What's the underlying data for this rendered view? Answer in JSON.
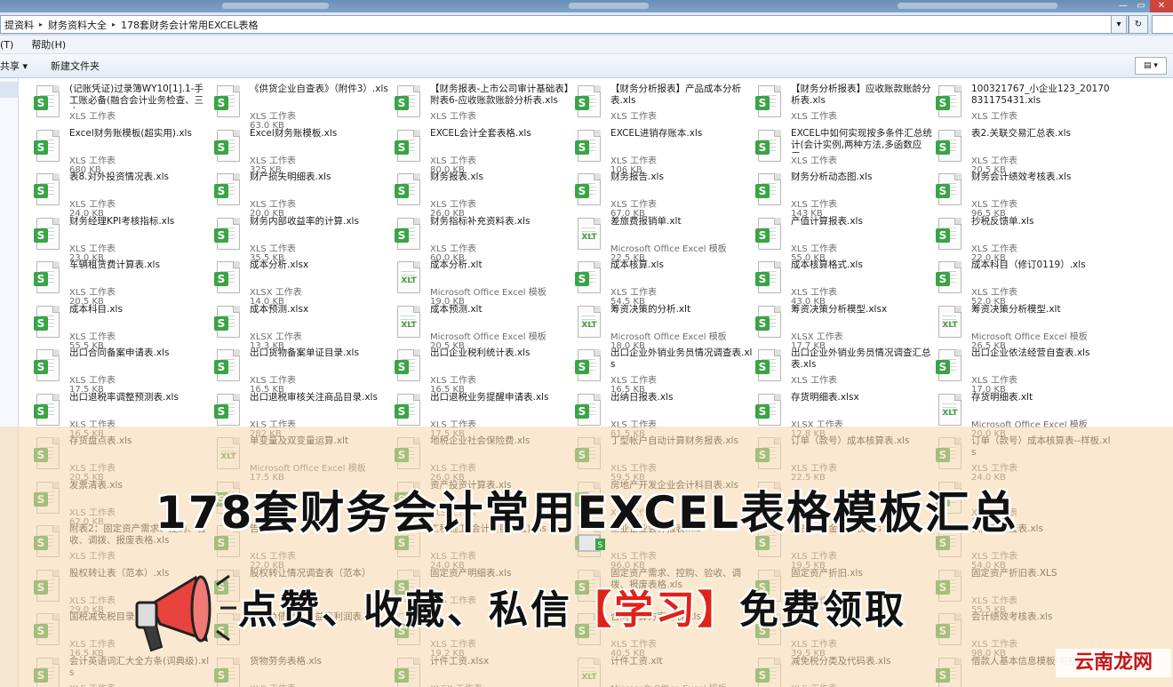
{
  "window": {
    "min": "—",
    "max": "▭",
    "close": "✕"
  },
  "address": {
    "crumbs": [
      "提资料",
      "财务资料大全",
      "178套财务会计常用EXCEL表格"
    ],
    "refresh": "↻",
    "dropdown": "▾"
  },
  "menu": {
    "tools": "(T)",
    "help": "帮助(H)"
  },
  "toolbar": {
    "share": "共享 ▾",
    "new_folder": "新建文件夹",
    "view": "▤ ▾"
  },
  "files": [
    {
      "name": "(记账凭证)过录簿WY10[1].1-手工账必备(融合会计业务检查、三大...",
      "type": "XLS 工作表",
      "size": "",
      "icon": "xls"
    },
    {
      "name": "《供货企业自查表》（附件3）.xls",
      "type": "XLS 工作表",
      "size": "63.0 KB",
      "icon": "xls"
    },
    {
      "name": "【财务报表-上市公司审计基础表】附表6-应收账款账龄分析表.xls",
      "type": "XLS 工作表",
      "size": "",
      "icon": "xls"
    },
    {
      "name": "【财务分析报表】产品成本分析表.xls",
      "type": "XLS 工作表",
      "size": "",
      "icon": "xls"
    },
    {
      "name": "【财务分析报表】应收账款账龄分析表.xls",
      "type": "XLS 工作表",
      "size": "",
      "icon": "xls"
    },
    {
      "name": "100321767_小企业123_20170831175431.xls",
      "type": "XLS 工作表",
      "size": "",
      "icon": "xls"
    },
    {
      "name": "Excel财务账模板(超实用).xls",
      "type": "XLS 工作表",
      "size": "680 KB",
      "icon": "xls"
    },
    {
      "name": "Excel财务账模板.xls",
      "type": "XLS 工作表",
      "size": "325 KB",
      "icon": "xls"
    },
    {
      "name": "EXCEL会计全套表格.xls",
      "type": "XLS 工作表",
      "size": "80.0 KB",
      "icon": "xls"
    },
    {
      "name": "EXCEL进销存账本.xls",
      "type": "XLS 工作表",
      "size": "106 KB",
      "icon": "xls"
    },
    {
      "name": "EXCEL中如何实现按多条件汇总统计(会计实例,两种方法,多函数应用...",
      "type": "XLS 工作表",
      "size": "",
      "icon": "xls"
    },
    {
      "name": "表2.关联交易汇总表.xls",
      "type": "XLS 工作表",
      "size": "20.5 KB",
      "icon": "xls"
    },
    {
      "name": "表8.对外投资情况表.xls",
      "type": "XLS 工作表",
      "size": "24.0 KB",
      "icon": "xls"
    },
    {
      "name": "财产损失明细表.xls",
      "type": "XLS 工作表",
      "size": "20.0 KB",
      "icon": "xls"
    },
    {
      "name": "财务报表.xls",
      "type": "XLS 工作表",
      "size": "26.0 KB",
      "icon": "xls"
    },
    {
      "name": "财务报告.xls",
      "type": "XLS 工作表",
      "size": "67.0 KB",
      "icon": "xls"
    },
    {
      "name": "财务分析动态图.xls",
      "type": "XLS 工作表",
      "size": "143 KB",
      "icon": "xls"
    },
    {
      "name": "财务会计绩效考核表.xls",
      "type": "XLS 工作表",
      "size": "96.5 KB",
      "icon": "xls"
    },
    {
      "name": "财务经理KPI考核指标.xls",
      "type": "XLS 工作表",
      "size": "23.0 KB",
      "icon": "xls"
    },
    {
      "name": "财务内部收益率的计算.xls",
      "type": "XLS 工作表",
      "size": "35.5 KB",
      "icon": "xls"
    },
    {
      "name": "财务指标补充资料表.xls",
      "type": "XLS 工作表",
      "size": "60.0 KB",
      "icon": "xls"
    },
    {
      "name": "差旅费报销单.xlt",
      "type": "Microsoft Office Excel 模板",
      "size": "22.5 KB",
      "icon": "xlt"
    },
    {
      "name": "产值计算报表.xls",
      "type": "XLS 工作表",
      "size": "55.0 KB",
      "icon": "xls"
    },
    {
      "name": "抄税反馈单.xls",
      "type": "XLS 工作表",
      "size": "22.0 KB",
      "icon": "xls"
    },
    {
      "name": "车辆租赁费计算表.xls",
      "type": "XLS 工作表",
      "size": "20.5 KB",
      "icon": "xls"
    },
    {
      "name": "成本分析.xlsx",
      "type": "XLSX 工作表",
      "size": "14.0 KB",
      "icon": "xlsx"
    },
    {
      "name": "成本分析.xlt",
      "type": "Microsoft Office Excel 模板",
      "size": "19.0 KB",
      "icon": "xlt"
    },
    {
      "name": "成本核算.xls",
      "type": "XLS 工作表",
      "size": "54.5 KB",
      "icon": "xls"
    },
    {
      "name": "成本核算格式.xls",
      "type": "XLS 工作表",
      "size": "43.0 KB",
      "icon": "xls"
    },
    {
      "name": "成本科目（修订0119）.xls",
      "type": "XLS 工作表",
      "size": "52.0 KB",
      "icon": "xls"
    },
    {
      "name": "成本科目.xls",
      "type": "XLS 工作表",
      "size": "55.5 KB",
      "icon": "xls"
    },
    {
      "name": "成本预测.xlsx",
      "type": "XLSX 工作表",
      "size": "13.3 KB",
      "icon": "xlsx"
    },
    {
      "name": "成本预测.xlt",
      "type": "Microsoft Office Excel 模板",
      "size": "20.5 KB",
      "icon": "xlt"
    },
    {
      "name": "筹资决策的分析.xlt",
      "type": "Microsoft Office Excel 模板",
      "size": "18.0 KB",
      "icon": "xlt"
    },
    {
      "name": "筹资决策分析模型.xlsx",
      "type": "XLSX 工作表",
      "size": "17.7 KB",
      "icon": "xlsx"
    },
    {
      "name": "筹资决策分析模型.xlt",
      "type": "Microsoft Office Excel 模板",
      "size": "26.5 KB",
      "icon": "xlt"
    },
    {
      "name": "出口合同备案申请表.xls",
      "type": "XLS 工作表",
      "size": "17.5 KB",
      "icon": "xls"
    },
    {
      "name": "出口货物备案单证目录.xls",
      "type": "XLS 工作表",
      "size": "16.5 KB",
      "icon": "xls"
    },
    {
      "name": "出口企业税利统计表.xls",
      "type": "XLS 工作表",
      "size": "16.5 KB",
      "icon": "xls"
    },
    {
      "name": "出口企业外销业务员情况调查表.xls",
      "type": "XLS 工作表",
      "size": "16.5 KB",
      "icon": "xls"
    },
    {
      "name": "出口企业外销业务员情况调查汇总表.xls",
      "type": "XLS 工作表",
      "size": "",
      "icon": "xls"
    },
    {
      "name": "出口企业依法经营自查表.xls",
      "type": "XLS 工作表",
      "size": "17.0 KB",
      "icon": "xls"
    },
    {
      "name": "出口退税率调整预测表.xls",
      "type": "XLS 工作表",
      "size": "16.5 KB",
      "icon": "xls"
    },
    {
      "name": "出口退税审核关注商品目录.xls",
      "type": "XLS 工作表",
      "size": "282 KB",
      "icon": "xls"
    },
    {
      "name": "出口退税业务提醒申请表.xls",
      "type": "XLS 工作表",
      "size": "17.5 KB",
      "icon": "xls"
    },
    {
      "name": "出纳日报表.xls",
      "type": "XLS 工作表",
      "size": "61.5 KB",
      "icon": "xls"
    },
    {
      "name": "存货明细表.xlsx",
      "type": "XLSX 工作表",
      "size": "12.8 KB",
      "icon": "xlsx"
    },
    {
      "name": "存货明细表.xlt",
      "type": "Microsoft Office Excel 模板",
      "size": "20.0 KB",
      "icon": "xlt"
    },
    {
      "name": "存货盘点表.xls",
      "type": "XLS 工作表",
      "size": "20.5 KB",
      "icon": "xls"
    },
    {
      "name": "单变量及双变量运算.xlt",
      "type": "Microsoft Office Excel 模板",
      "size": "17.5 KB",
      "icon": "xlt"
    },
    {
      "name": "地税企业社会保险费.xls",
      "type": "XLS 工作表",
      "size": "26.0 KB",
      "icon": "xls"
    },
    {
      "name": "丁型帐户自动计算财务报表.xls",
      "type": "XLS 工作表",
      "size": "59.5 KB",
      "icon": "xls"
    },
    {
      "name": "订单（款号）成本核算表.xls",
      "type": "XLS 工作表",
      "size": "22.5 KB",
      "icon": "xls"
    },
    {
      "name": "订单（款号）成本核算表--样板.xls",
      "type": "XLS 工作表",
      "size": "24.0 KB",
      "icon": "xls"
    },
    {
      "name": "发票清表.xls",
      "type": "XLS 工作表",
      "size": "62.0 KB",
      "icon": "xls"
    },
    {
      "name": "",
      "type": "",
      "size": "",
      "icon": "xls"
    },
    {
      "name": "资产投资计算表.xls",
      "type": "XLS 工作表",
      "size": "",
      "icon": "xls"
    },
    {
      "name": "房地产开发企业会计科目表.xls",
      "type": "XLS 工作表",
      "size": "",
      "icon": "xls"
    },
    {
      "name": "",
      "type": "",
      "size": "",
      "icon": "xls"
    },
    {
      "name": "",
      "type": "XLS 工作表",
      "size": "16.0 KB",
      "icon": "xls"
    },
    {
      "name": "附表2：固定资产需求、控购、验收、调拨、报废表格.xls",
      "type": "XLS 工作表",
      "size": "",
      "icon": "xls"
    },
    {
      "name": "告表.xls",
      "type": "XLS 工作表",
      "size": "22.0 KB",
      "icon": "xls"
    },
    {
      "name": "工程施工(会计科目设置).xls",
      "type": "XLS 工作表",
      "size": "24.0 KB",
      "icon": "xls"
    },
    {
      "name": "工业企业会计报表.xls",
      "type": "XLS 工作表",
      "size": "96.0 KB",
      "icon": "xls"
    },
    {
      "name": "工资、薪金税额表.xls",
      "type": "XLS 工作表",
      "size": "19.5 KB",
      "icon": "xls"
    },
    {
      "name": "供应商自查表.xls",
      "type": "XLS 工作表",
      "size": "54.0 KB",
      "icon": "xls"
    },
    {
      "name": "股权转让表（范本）.xls",
      "type": "XLS 工作表",
      "size": "29.0 KB",
      "icon": "xls"
    },
    {
      "name": "股权转让情况调查表（范本）",
      "type": "",
      "size": "",
      "icon": "xls"
    },
    {
      "name": "固定资产明细表.xls",
      "type": "XLS 工作表",
      "size": "",
      "icon": "xls"
    },
    {
      "name": "固定资产需求、控购、验收、调拨、报废表格.xls",
      "type": "",
      "size": "",
      "icon": "xls"
    },
    {
      "name": "固定资产折旧.xls",
      "type": "XLS 工作表",
      "size": "",
      "icon": "xls"
    },
    {
      "name": "固定资产折旧表.XLS",
      "type": "XLS 工作表",
      "size": "55.5 KB",
      "icon": "xls"
    },
    {
      "name": "国税减免税目录.xls",
      "type": "XLS 工作表",
      "size": "16.5 KB",
      "icon": "xls"
    },
    {
      "name": "资产负债表、损益表利润表、权...",
      "type": "",
      "size": "",
      "icon": "xls"
    },
    {
      "name": "",
      "type": "XLS 工作表",
      "size": "19.2 KB",
      "icon": "xls"
    },
    {
      "name": "合同预算方案总表.xls",
      "type": "XLS 工作表",
      "size": "40.5 KB",
      "icon": "xls"
    },
    {
      "name": "",
      "type": "XLS 工作表",
      "size": "39.5 KB",
      "icon": "xls"
    },
    {
      "name": "会计绩效考核表.xls",
      "type": "XLS 工作表",
      "size": "98.0 KB",
      "icon": "xls"
    },
    {
      "name": "会计英语词汇大全方条(词典级).xls",
      "type": "XLS 工作表",
      "size": "",
      "icon": "xls"
    },
    {
      "name": "货物劳务表格.xls",
      "type": "XLS 工作表",
      "size": "",
      "icon": "xls"
    },
    {
      "name": "计件工资.xlsx",
      "type": "XLSX 工作表",
      "size": "",
      "icon": "xlsx"
    },
    {
      "name": "计件工资.xlt",
      "type": "Microsoft Office Excel 模板",
      "size": "",
      "icon": "xlt"
    },
    {
      "name": "减免税分类及代码表.xls",
      "type": "XLS 工作表",
      "size": "",
      "icon": "xls"
    },
    {
      "name": "借款人基本信息模板(可打印).xls",
      "type": "",
      "size": "",
      "icon": "xls"
    }
  ],
  "banner": {
    "headline": "178套财务会计常用EXCEL表格模板汇总",
    "sub_a": "点赞、收藏、私信",
    "sub_b": "【学习】",
    "sub_c": "免费领取"
  },
  "watermark": "云南龙网",
  "colors": {
    "xls_green": "#3aa447",
    "highlight_red": "#e0221b",
    "overlay": "#f6d6aa"
  }
}
